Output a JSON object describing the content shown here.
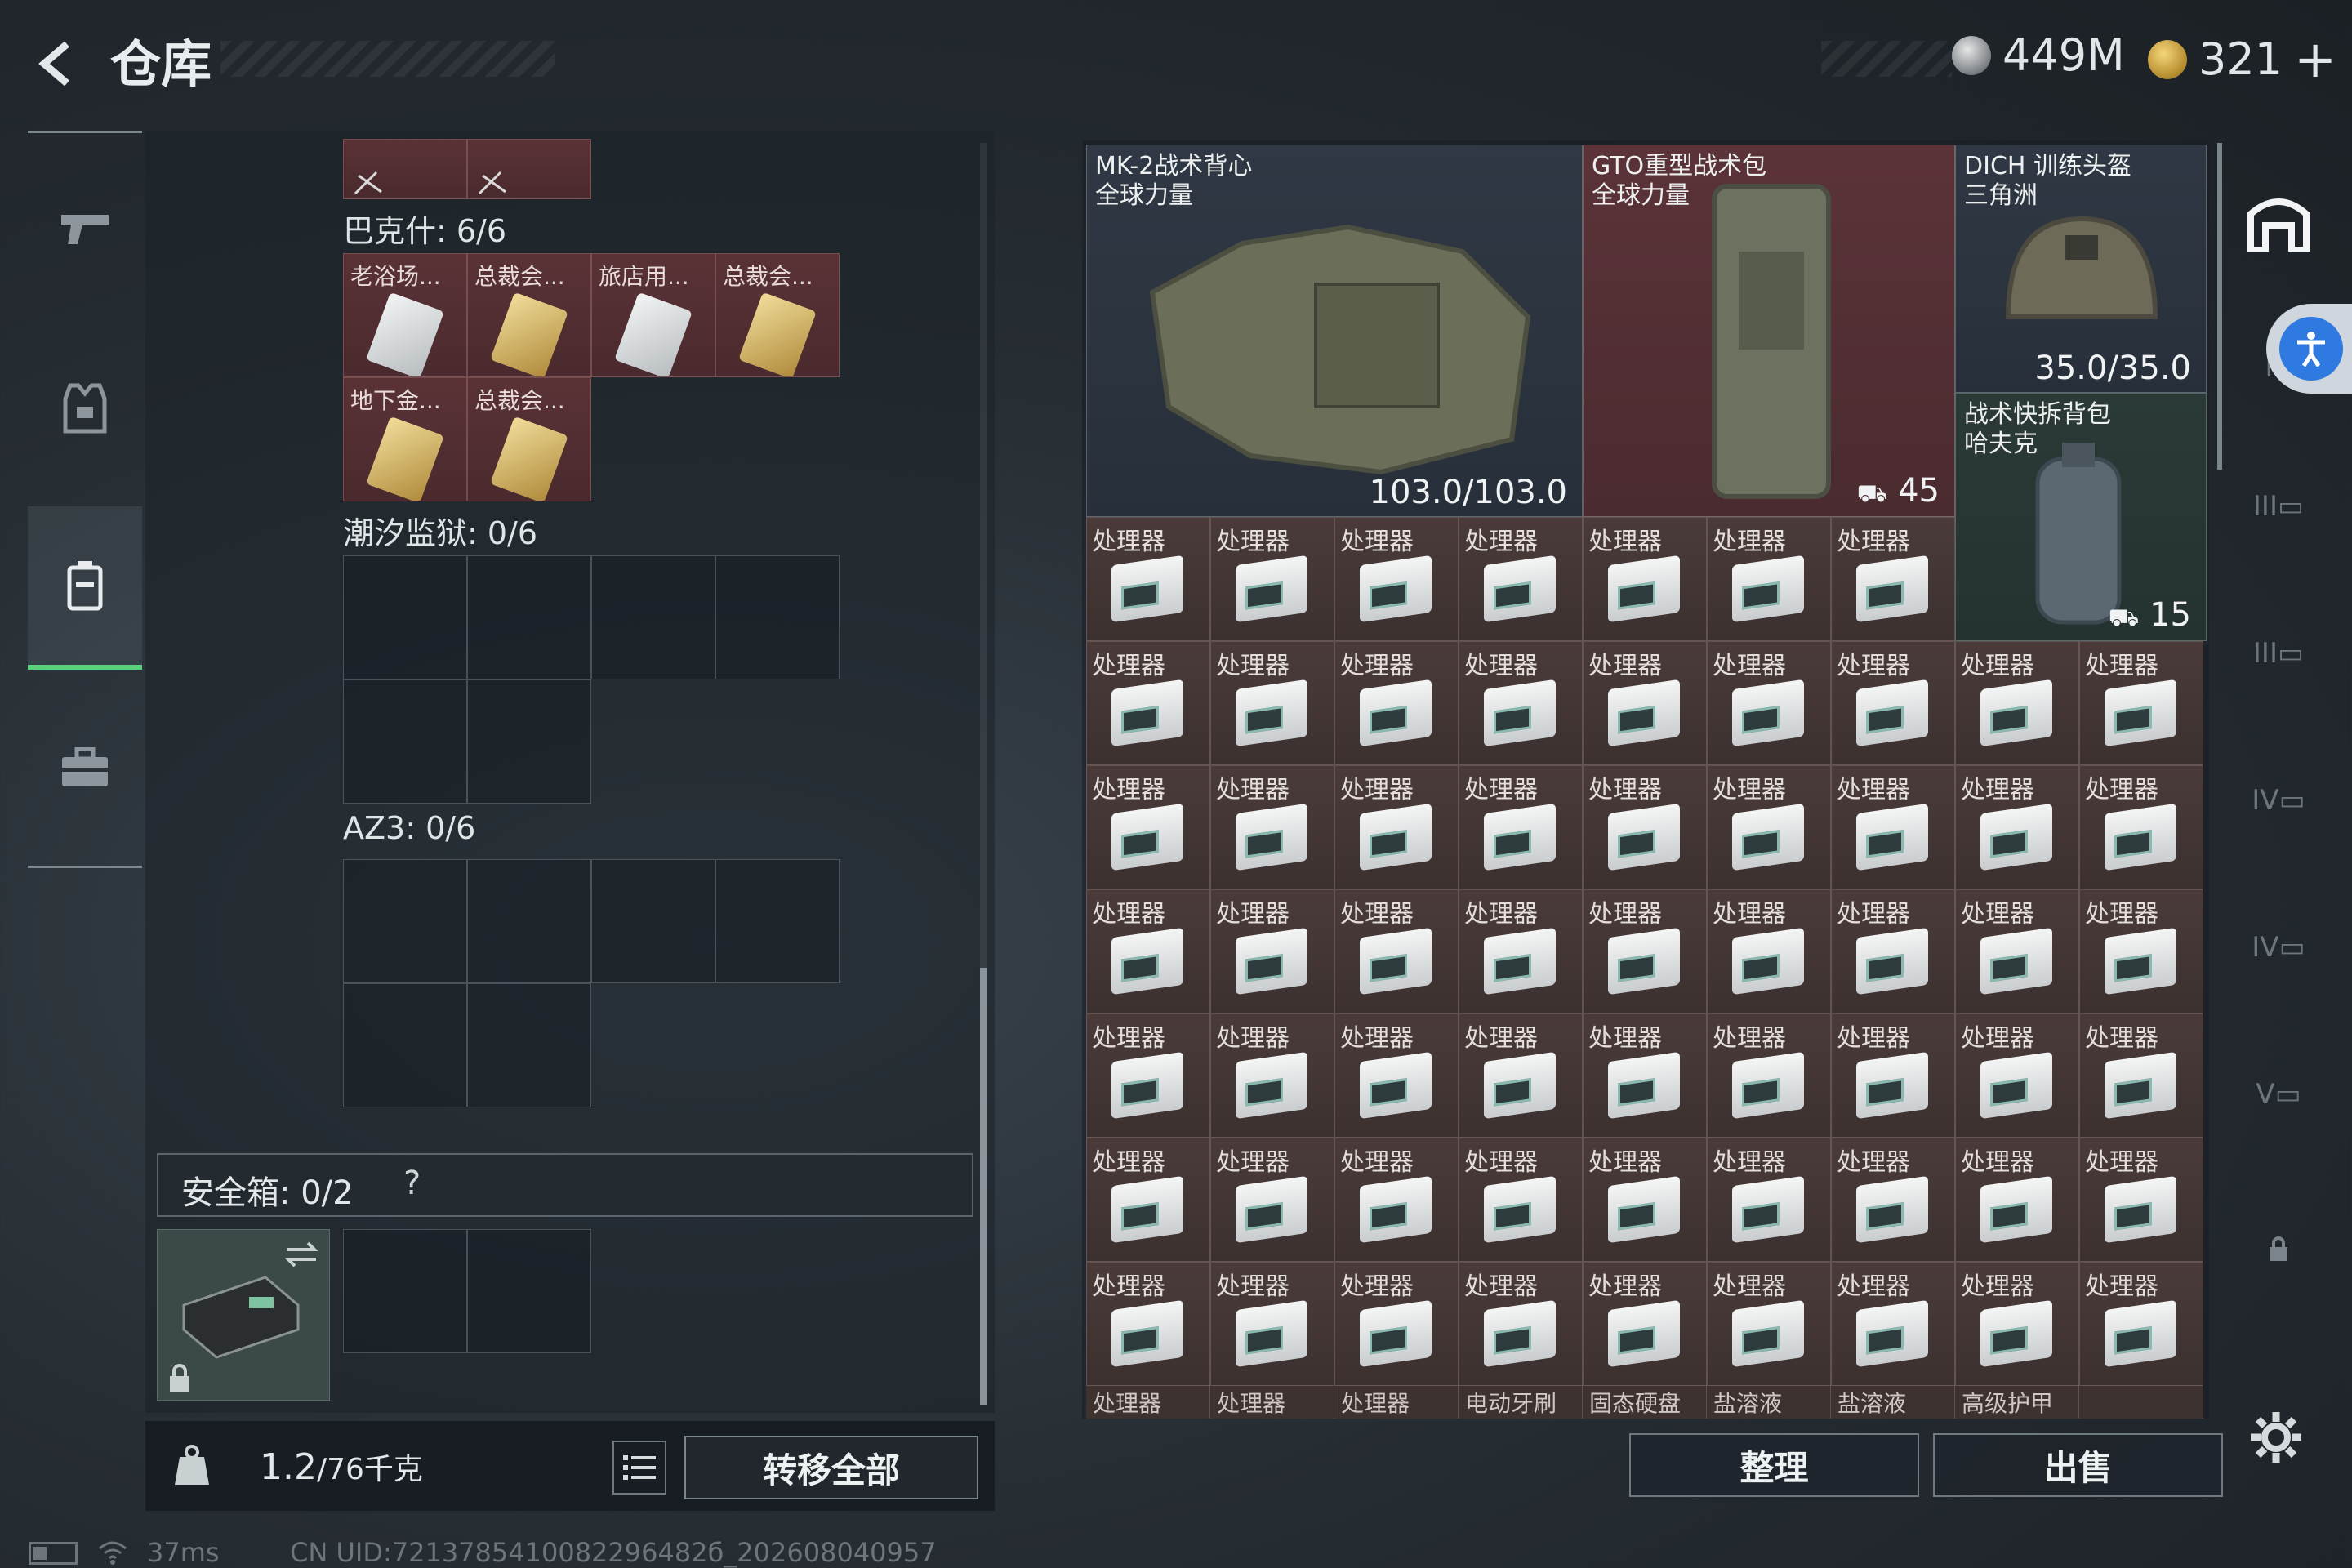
{
  "header": {
    "title": "仓库",
    "silver_amount": "449M",
    "gold_amount": "321",
    "plus_label": "+"
  },
  "left_nav": {
    "items": [
      {
        "icon": "pistol-icon"
      },
      {
        "icon": "vest-icon"
      },
      {
        "icon": "backpack-icon",
        "active": true
      },
      {
        "icon": "briefcase-icon"
      }
    ]
  },
  "containers": {
    "top_cells": [
      {
        "icon": "tag-icon"
      },
      {
        "icon": "tag-icon"
      }
    ],
    "bakeshi": {
      "label": "巴克什: 6/6",
      "items": [
        "老浴场...",
        "总裁会...",
        "旅店用...",
        "总裁会...",
        "地下金...",
        "总裁会..."
      ]
    },
    "chaoxi": {
      "label": "潮汐监狱: 0/6"
    },
    "az3": {
      "label": "AZ3: 0/6"
    }
  },
  "safebox": {
    "label": "安全箱: 0/2",
    "help": "?"
  },
  "footer_left": {
    "weight_value": "1.2",
    "weight_total": "/76千克",
    "weight_icon_label": "KG",
    "transfer_all": "转移全部"
  },
  "stash": {
    "big_items": [
      {
        "name": "MK-2战术背心",
        "sub": "全球力量",
        "value": "103.0/103.0"
      },
      {
        "name": "GTO重型战术包",
        "sub": "全球力量",
        "value": "45"
      },
      {
        "name": "DICH 训练头盔",
        "sub": "三角洲",
        "value": "35.0/35.0"
      },
      {
        "name": "战术快拆背包",
        "sub": "哈夫克",
        "value": "15"
      }
    ],
    "processor_label": "处理器",
    "bottom_row": [
      "处理器",
      "处理器",
      "处理器",
      "电动牙刷",
      "固态硬盘",
      "盐溶液",
      "盐溶液",
      "高级护甲",
      ""
    ]
  },
  "actions": {
    "sort": "整理",
    "sell": "出售"
  },
  "right_nav": {
    "tiers": [
      "IV",
      "III",
      "III",
      "IV",
      "IV",
      "V"
    ]
  },
  "status": {
    "ping": "37ms",
    "uid": "CN UID:7213785410082296482б_202608040957"
  },
  "colors": {
    "accent_green": "#5ad27a",
    "item_red": "#5a3236",
    "accessibility_blue": "#2f7ae0"
  }
}
